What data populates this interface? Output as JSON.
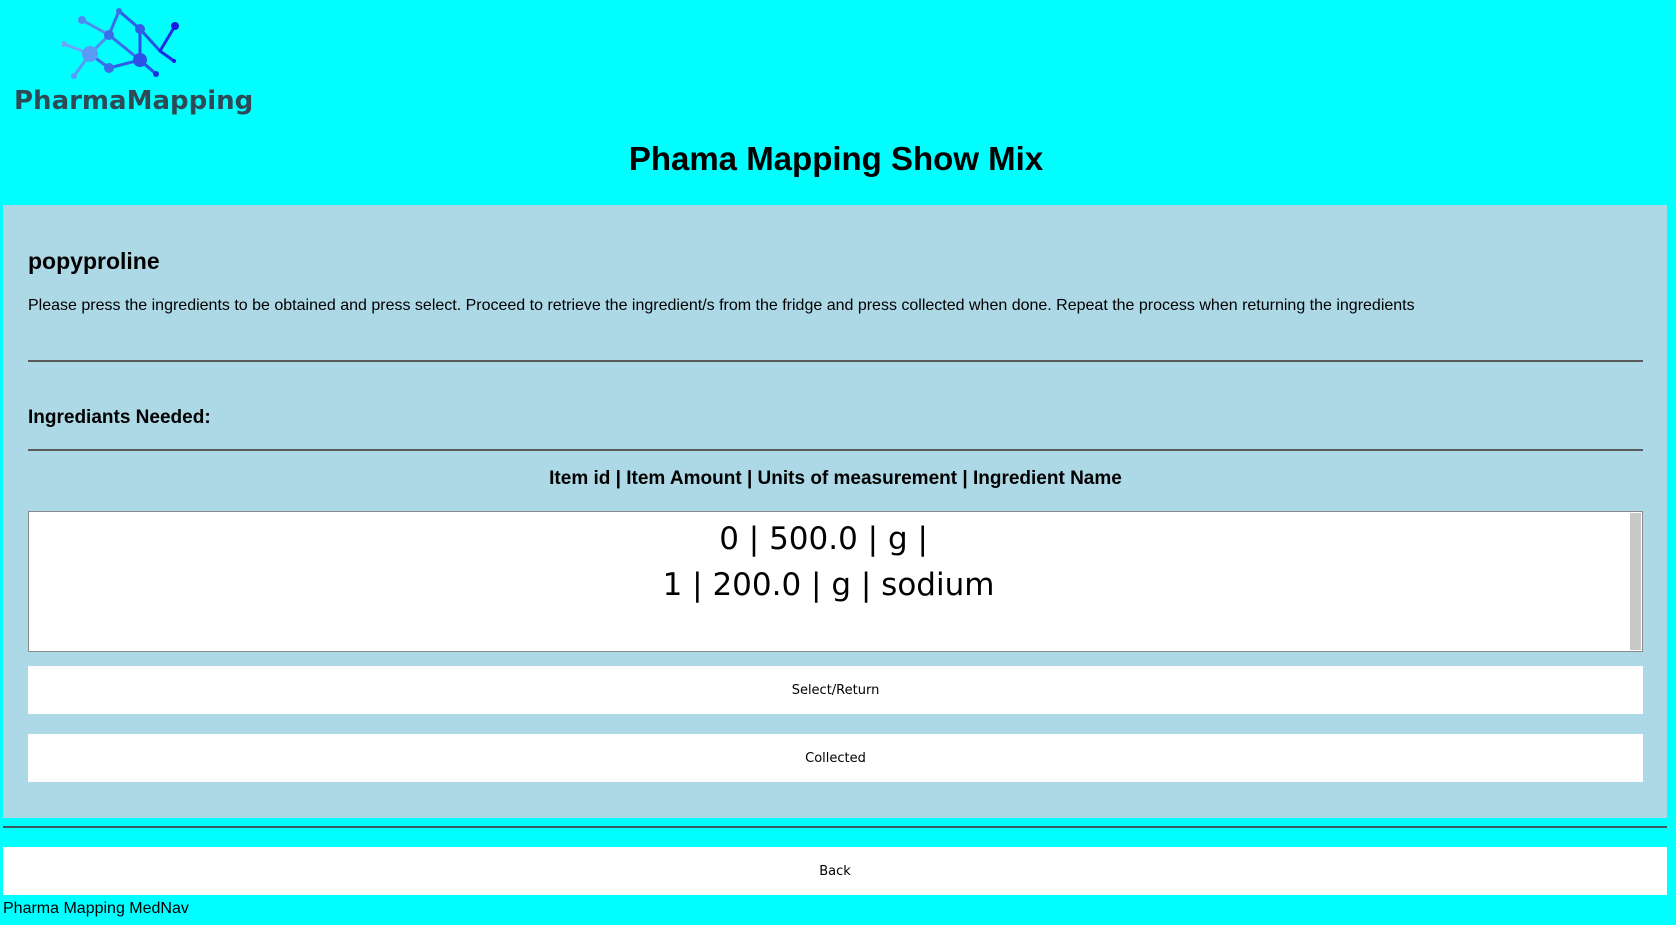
{
  "header": {
    "logo_icon": "molecule-network-icon",
    "logo_text": "PharmaMapping",
    "title": "Phama Mapping Show Mix"
  },
  "mix": {
    "name": "popyproline",
    "instructions": "Please press the ingredients to be obtained and press select. Proceed to retrieve the ingredient/s from the fridge and press collected when done. Repeat the process when returning the ingredients"
  },
  "ingredients": {
    "heading": "Ingrediants Needed:",
    "columns_header": "Item id | Item Amount | Units of measurement | Ingredient Name",
    "items": [
      "0 | 500.0 | g | ",
      "1 | 200.0 | g | sodium"
    ]
  },
  "buttons": {
    "select_label": "Select/Return",
    "collected_label": "Collected",
    "back_label": "Back"
  },
  "footer": {
    "text": "Pharma Mapping MedNav"
  },
  "colors": {
    "page_background": "#00ffff",
    "panel_background": "#add8e6",
    "logo_text": "#2d4a56",
    "logo_nodes": [
      "#5b9bf5",
      "#2e6be6",
      "#1a1ae6"
    ]
  }
}
